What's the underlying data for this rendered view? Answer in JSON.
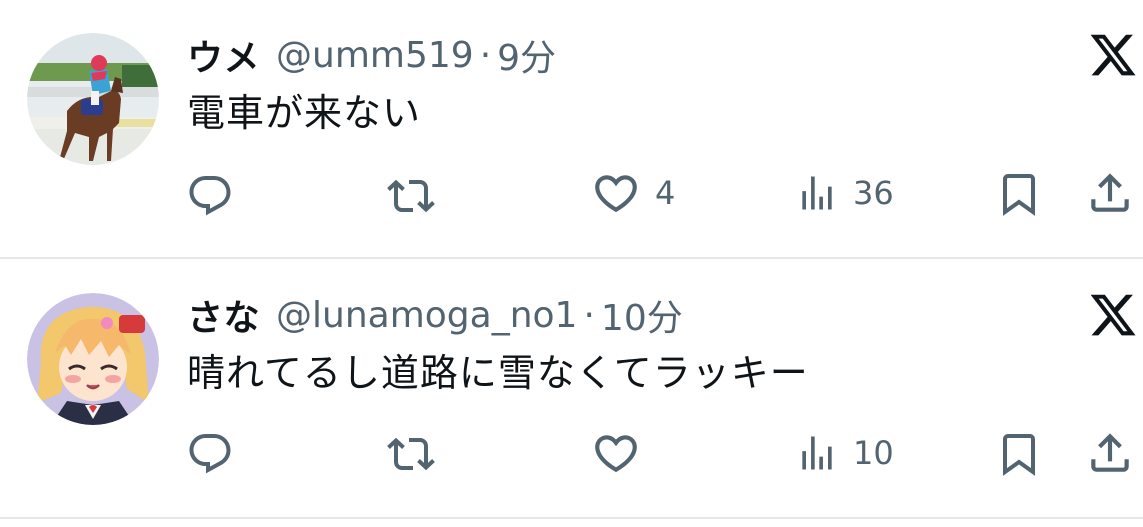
{
  "colors": {
    "text_primary": "#0f1419",
    "text_secondary": "#536471",
    "divider": "#e4e7ea"
  },
  "tweets": [
    {
      "name": "ウメ",
      "handle": "@umm519",
      "separator": "·",
      "time": "9分",
      "text": "電車が来ない",
      "avatar": "jockey-on-horse-photo",
      "likes": "4",
      "views": "36"
    },
    {
      "name": "さな",
      "handle": "@lunamoga_no1",
      "separator": "·",
      "time": "10分",
      "text": "晴れてるし道路に雪なくてラッキー",
      "avatar": "anime-girl-illustration",
      "likes": "",
      "views": "10"
    }
  ],
  "icons": [
    "reply-icon",
    "retweet-icon",
    "like-icon",
    "views-icon",
    "bookmark-icon",
    "share-icon",
    "x-logo-icon"
  ]
}
